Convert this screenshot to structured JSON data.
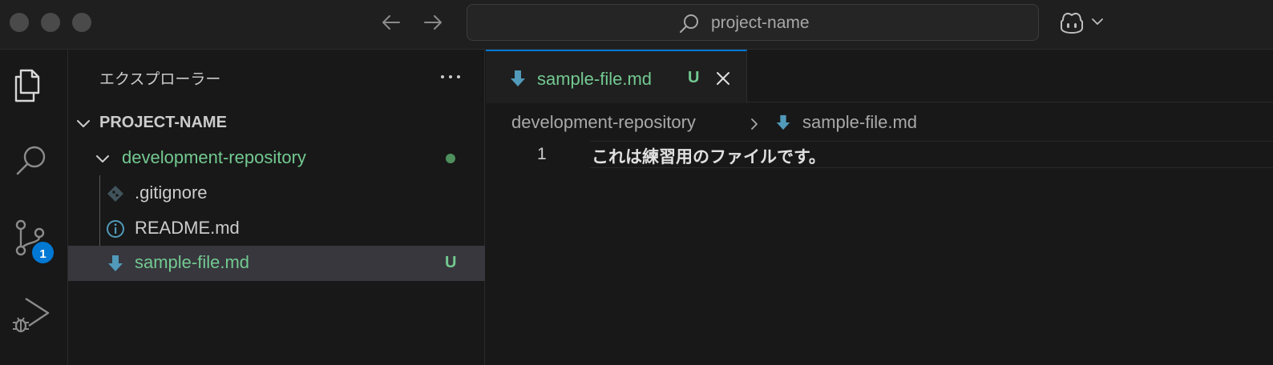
{
  "titlebar": {
    "search_text": "project-name"
  },
  "activity": {
    "scm_badge": "1"
  },
  "sidebar": {
    "title": "エクスプローラー",
    "root_folder": "PROJECT-NAME",
    "folder": {
      "name": "development-repository",
      "status_dot_color": "#4e8f5c"
    },
    "files": [
      {
        "name": ".gitignore",
        "icon": "git-file-icon",
        "status": ""
      },
      {
        "name": "README.md",
        "icon": "info-icon",
        "status": ""
      },
      {
        "name": "sample-file.md",
        "icon": "markdown-arrow-icon",
        "status": "U"
      }
    ]
  },
  "editor": {
    "tab": {
      "label": "sample-file.md",
      "status": "U"
    },
    "breadcrumb": [
      "development-repository",
      "sample-file.md"
    ],
    "lines": [
      {
        "number": "1",
        "text": "これは練習用のファイルです。"
      }
    ]
  },
  "colors": {
    "untracked_green": "#73c991",
    "accent_blue": "#0078d4",
    "markdown_icon_blue": "#519aba"
  }
}
